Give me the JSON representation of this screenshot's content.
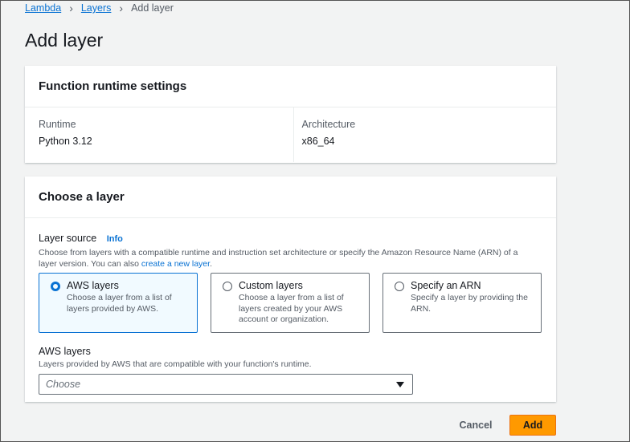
{
  "breadcrumb": {
    "item1": "Lambda",
    "item2": "Layers",
    "current": "Add layer"
  },
  "page_title": "Add layer",
  "runtime_settings": {
    "title": "Function runtime settings",
    "runtime_label": "Runtime",
    "runtime_value": "Python 3.12",
    "architecture_label": "Architecture",
    "architecture_value": "x86_64"
  },
  "choose_layer": {
    "title": "Choose a layer",
    "source_label": "Layer source",
    "info_link": "Info",
    "description_prefix": "Choose from layers with a compatible runtime and instruction set architecture or specify the Amazon Resource Name (ARN) of a layer version. You can also ",
    "create_link": "create a new layer",
    "description_suffix": ".",
    "options": [
      {
        "title": "AWS layers",
        "description": "Choose a layer from a list of layers provided by AWS.",
        "selected": true
      },
      {
        "title": "Custom layers",
        "description": "Choose a layer from a list of layers created by your AWS account or organization.",
        "selected": false
      },
      {
        "title": "Specify an ARN",
        "description": "Specify a layer by providing the ARN.",
        "selected": false
      }
    ],
    "aws_layers_label": "AWS layers",
    "aws_layers_description": "Layers provided by AWS that are compatible with your function's runtime.",
    "select_placeholder": "Choose"
  },
  "actions": {
    "cancel": "Cancel",
    "add": "Add"
  },
  "colors": {
    "primary_button": "#ff9900",
    "link": "#0972d3",
    "selected_tile_bg": "#f1faff"
  }
}
